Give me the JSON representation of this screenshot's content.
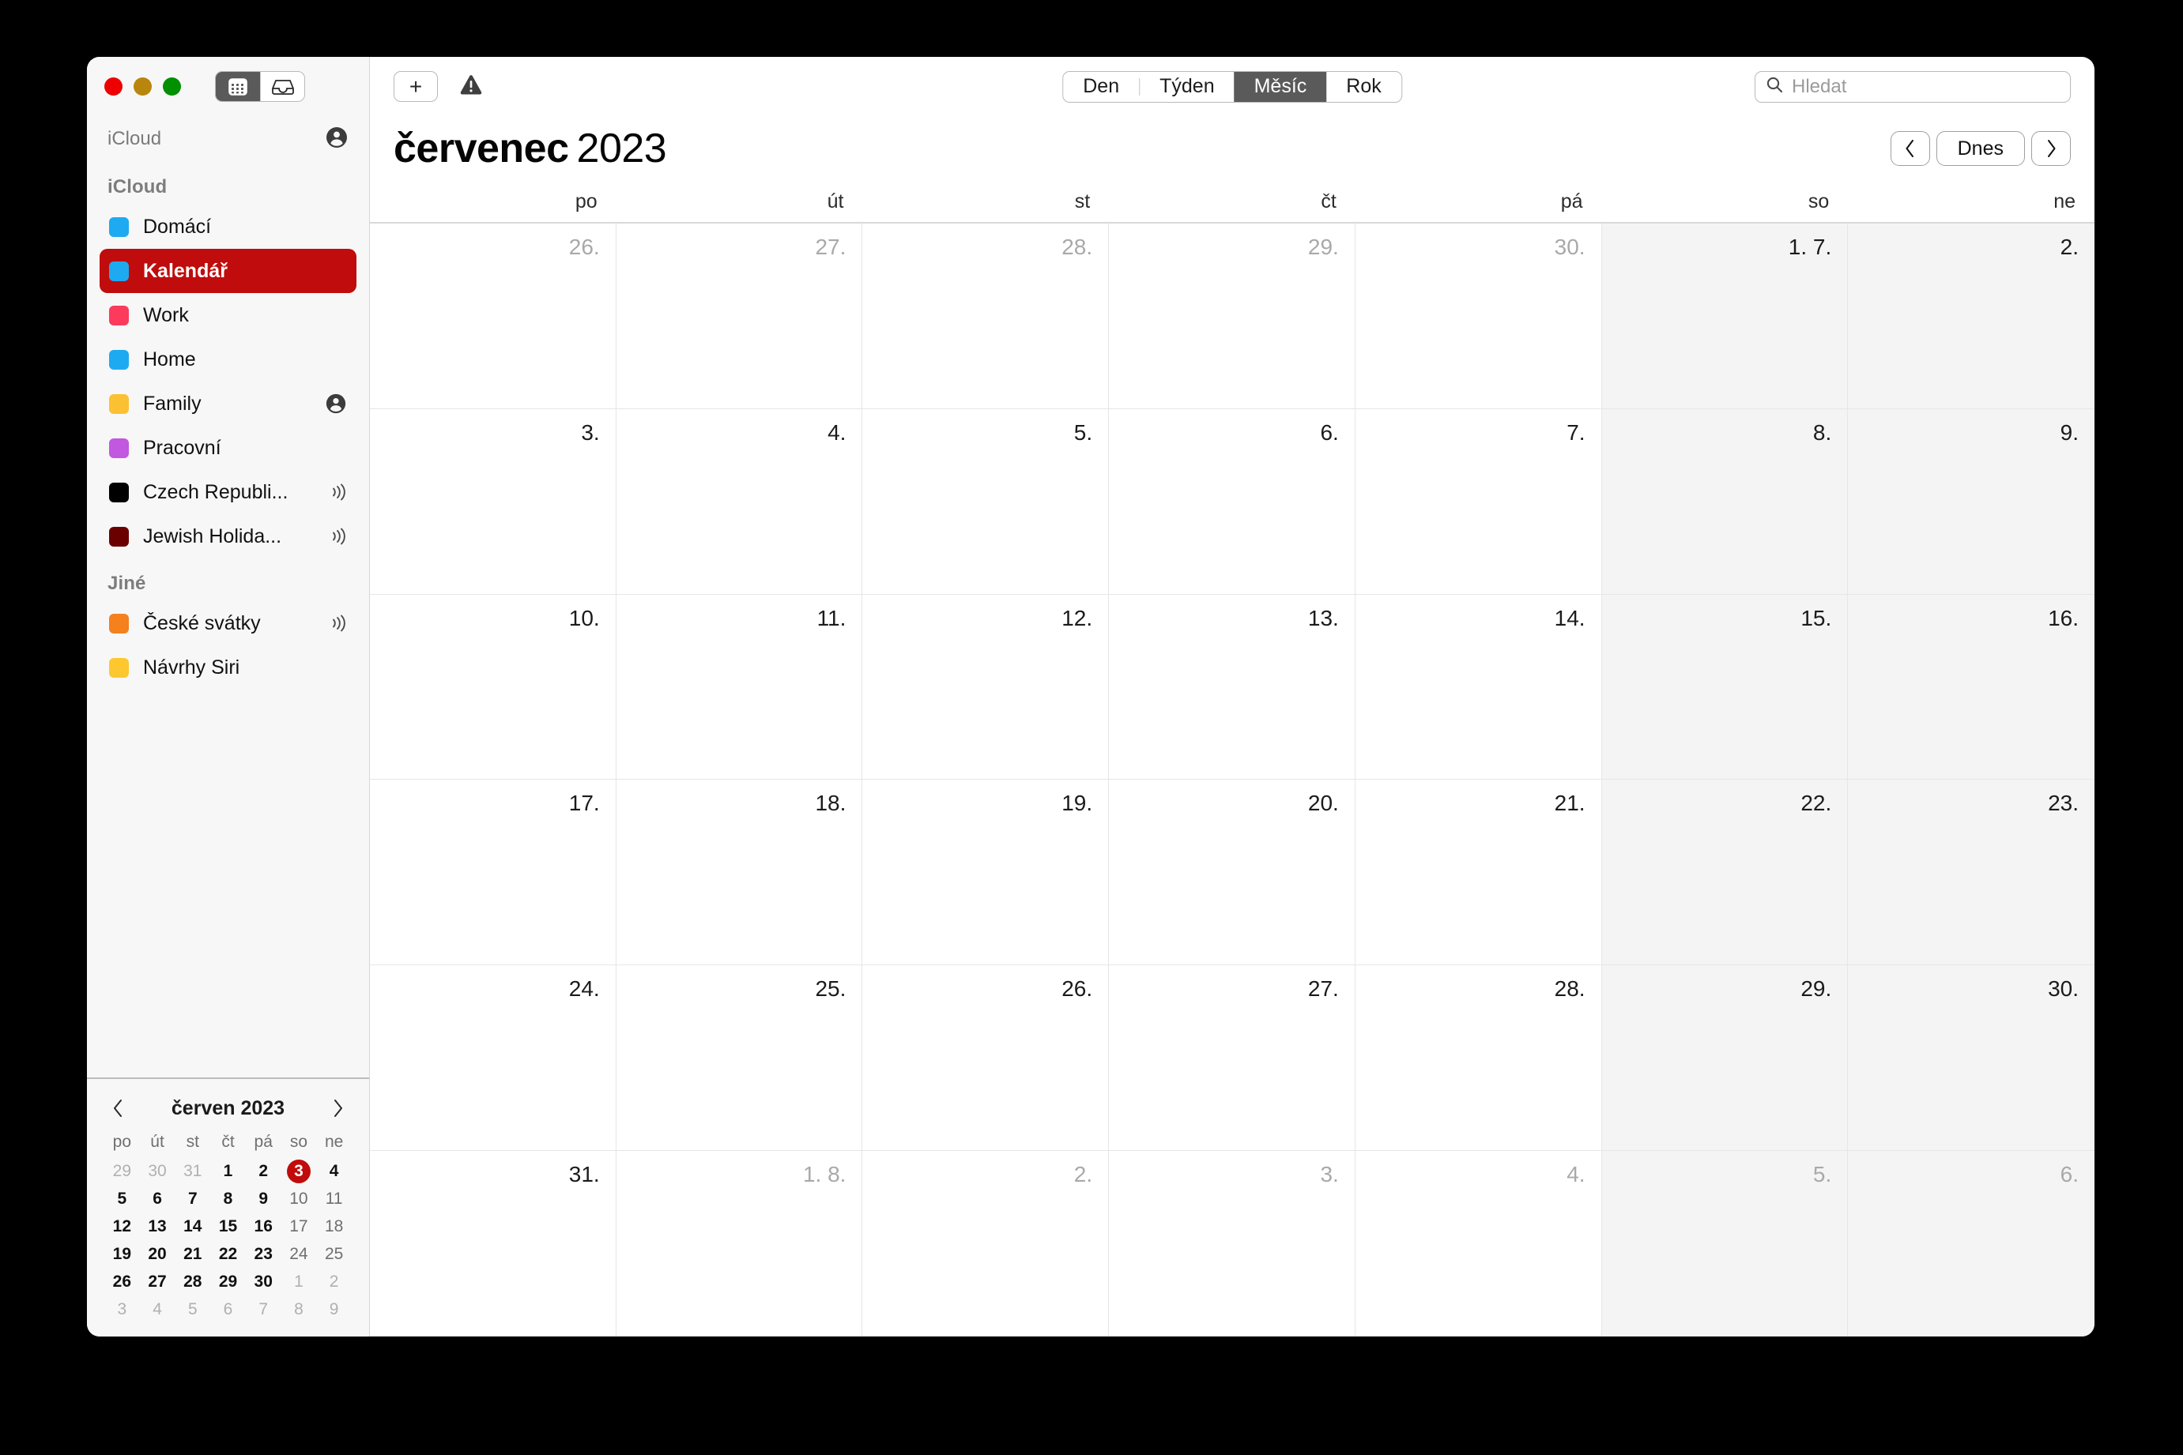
{
  "window": {
    "traffic_lights": [
      "close",
      "minimize",
      "zoom"
    ],
    "view_toggle": [
      {
        "name": "calendar-view-icon",
        "active": true
      },
      {
        "name": "inbox-view-icon",
        "active": false
      }
    ]
  },
  "sidebar": {
    "account_row": {
      "label": "iCloud",
      "icon": "account-circle-icon"
    },
    "sections": [
      {
        "title": "iCloud",
        "items": [
          {
            "label": "Domácí",
            "color": "#1eaaf1",
            "selected": false,
            "badge": ""
          },
          {
            "label": "Kalendář",
            "color": "#1eaaf1",
            "selected": true,
            "badge": ""
          },
          {
            "label": "Work",
            "color": "#fb3a5c",
            "selected": false,
            "badge": ""
          },
          {
            "label": "Home",
            "color": "#1eaaf1",
            "selected": false,
            "badge": ""
          },
          {
            "label": "Family",
            "color": "#fcc133",
            "selected": false,
            "badge": "account"
          },
          {
            "label": "Pracovní",
            "color": "#c257e0",
            "selected": false,
            "badge": ""
          },
          {
            "label": "Czech Republi...",
            "color": "#000000",
            "selected": false,
            "badge": "subscribed"
          },
          {
            "label": "Jewish Holida...",
            "color": "#6b0000",
            "selected": false,
            "badge": "subscribed"
          }
        ]
      },
      {
        "title": "Jiné",
        "items": [
          {
            "label": "České svátky",
            "color": "#f5801e",
            "selected": false,
            "badge": "subscribed"
          },
          {
            "label": "Návrhy Siri",
            "color": "#fdc82f",
            "selected": false,
            "badge": ""
          }
        ]
      }
    ],
    "minicalendar": {
      "title": "červen 2023",
      "prev_label": "‹",
      "next_label": "›",
      "weekdays": [
        "po",
        "út",
        "st",
        "čt",
        "pá",
        "so",
        "ne"
      ],
      "weeks": [
        [
          {
            "d": "29",
            "state": "muted"
          },
          {
            "d": "30",
            "state": "muted"
          },
          {
            "d": "31",
            "state": "muted"
          },
          {
            "d": "1",
            "state": "current"
          },
          {
            "d": "2",
            "state": "current"
          },
          {
            "d": "3",
            "state": "today"
          },
          {
            "d": "4",
            "state": "current"
          }
        ],
        [
          {
            "d": "5",
            "state": "current"
          },
          {
            "d": "6",
            "state": "current"
          },
          {
            "d": "7",
            "state": "current"
          },
          {
            "d": "8",
            "state": "current"
          },
          {
            "d": "9",
            "state": "current"
          },
          {
            "d": "10",
            "state": "weekend"
          },
          {
            "d": "11",
            "state": "weekend"
          }
        ],
        [
          {
            "d": "12",
            "state": "current"
          },
          {
            "d": "13",
            "state": "current"
          },
          {
            "d": "14",
            "state": "current"
          },
          {
            "d": "15",
            "state": "current"
          },
          {
            "d": "16",
            "state": "current"
          },
          {
            "d": "17",
            "state": "weekend"
          },
          {
            "d": "18",
            "state": "weekend"
          }
        ],
        [
          {
            "d": "19",
            "state": "current"
          },
          {
            "d": "20",
            "state": "current"
          },
          {
            "d": "21",
            "state": "current"
          },
          {
            "d": "22",
            "state": "current"
          },
          {
            "d": "23",
            "state": "current"
          },
          {
            "d": "24",
            "state": "weekend"
          },
          {
            "d": "25",
            "state": "weekend"
          }
        ],
        [
          {
            "d": "26",
            "state": "current"
          },
          {
            "d": "27",
            "state": "current"
          },
          {
            "d": "28",
            "state": "current"
          },
          {
            "d": "29",
            "state": "current"
          },
          {
            "d": "30",
            "state": "current"
          },
          {
            "d": "1",
            "state": "muted"
          },
          {
            "d": "2",
            "state": "muted"
          }
        ],
        [
          {
            "d": "3",
            "state": "muted"
          },
          {
            "d": "4",
            "state": "muted"
          },
          {
            "d": "5",
            "state": "muted"
          },
          {
            "d": "6",
            "state": "muted"
          },
          {
            "d": "7",
            "state": "muted"
          },
          {
            "d": "8",
            "state": "muted"
          },
          {
            "d": "9",
            "state": "muted"
          }
        ]
      ]
    }
  },
  "toolbar": {
    "add_label": "+",
    "warning_icon": "warning-triangle-icon",
    "views": [
      {
        "label": "Den",
        "active": false
      },
      {
        "label": "Týden",
        "active": false
      },
      {
        "label": "Měsíc",
        "active": true
      },
      {
        "label": "Rok",
        "active": false
      }
    ],
    "search_placeholder": "Hledat",
    "search_value": ""
  },
  "header": {
    "month": "červenec",
    "year": "2023",
    "prev_label": "‹",
    "today_label": "Dnes",
    "next_label": "›"
  },
  "month_view": {
    "weekdays": [
      "po",
      "út",
      "st",
      "čt",
      "pá",
      "so",
      "ne"
    ],
    "weeks": [
      [
        {
          "d": "26.",
          "other": true,
          "weekend": false
        },
        {
          "d": "27.",
          "other": true,
          "weekend": false
        },
        {
          "d": "28.",
          "other": true,
          "weekend": false
        },
        {
          "d": "29.",
          "other": true,
          "weekend": false
        },
        {
          "d": "30.",
          "other": true,
          "weekend": false
        },
        {
          "d": "1. 7.",
          "other": false,
          "weekend": true
        },
        {
          "d": "2.",
          "other": false,
          "weekend": true
        }
      ],
      [
        {
          "d": "3.",
          "other": false,
          "weekend": false
        },
        {
          "d": "4.",
          "other": false,
          "weekend": false
        },
        {
          "d": "5.",
          "other": false,
          "weekend": false
        },
        {
          "d": "6.",
          "other": false,
          "weekend": false
        },
        {
          "d": "7.",
          "other": false,
          "weekend": false
        },
        {
          "d": "8.",
          "other": false,
          "weekend": true
        },
        {
          "d": "9.",
          "other": false,
          "weekend": true
        }
      ],
      [
        {
          "d": "10.",
          "other": false,
          "weekend": false
        },
        {
          "d": "11.",
          "other": false,
          "weekend": false
        },
        {
          "d": "12.",
          "other": false,
          "weekend": false
        },
        {
          "d": "13.",
          "other": false,
          "weekend": false
        },
        {
          "d": "14.",
          "other": false,
          "weekend": false
        },
        {
          "d": "15.",
          "other": false,
          "weekend": true
        },
        {
          "d": "16.",
          "other": false,
          "weekend": true
        }
      ],
      [
        {
          "d": "17.",
          "other": false,
          "weekend": false
        },
        {
          "d": "18.",
          "other": false,
          "weekend": false
        },
        {
          "d": "19.",
          "other": false,
          "weekend": false
        },
        {
          "d": "20.",
          "other": false,
          "weekend": false
        },
        {
          "d": "21.",
          "other": false,
          "weekend": false
        },
        {
          "d": "22.",
          "other": false,
          "weekend": true
        },
        {
          "d": "23.",
          "other": false,
          "weekend": true
        }
      ],
      [
        {
          "d": "24.",
          "other": false,
          "weekend": false
        },
        {
          "d": "25.",
          "other": false,
          "weekend": false
        },
        {
          "d": "26.",
          "other": false,
          "weekend": false
        },
        {
          "d": "27.",
          "other": false,
          "weekend": false
        },
        {
          "d": "28.",
          "other": false,
          "weekend": false
        },
        {
          "d": "29.",
          "other": false,
          "weekend": true
        },
        {
          "d": "30.",
          "other": false,
          "weekend": true
        }
      ],
      [
        {
          "d": "31.",
          "other": false,
          "weekend": false
        },
        {
          "d": "1. 8.",
          "other": true,
          "weekend": false
        },
        {
          "d": "2.",
          "other": true,
          "weekend": false
        },
        {
          "d": "3.",
          "other": true,
          "weekend": false
        },
        {
          "d": "4.",
          "other": true,
          "weekend": false
        },
        {
          "d": "5.",
          "other": true,
          "weekend": true
        },
        {
          "d": "6.",
          "other": true,
          "weekend": true
        }
      ]
    ]
  }
}
